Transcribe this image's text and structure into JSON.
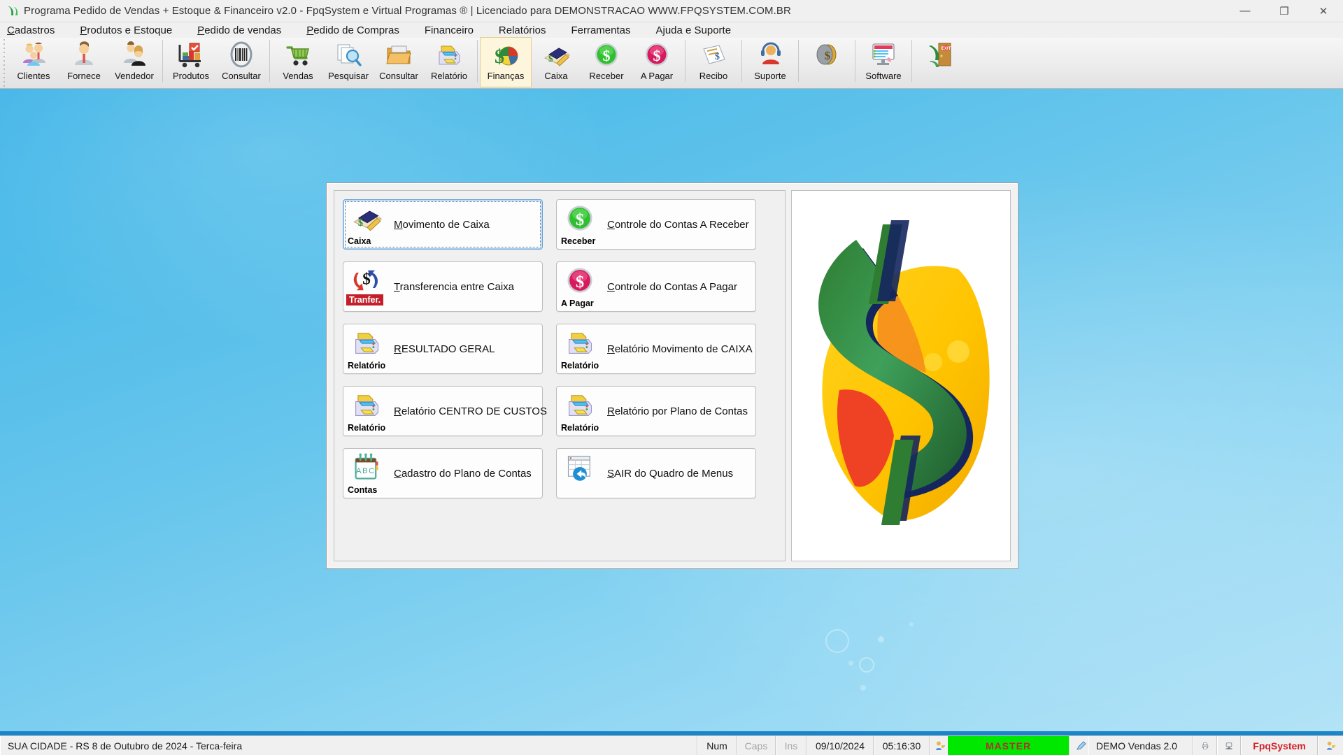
{
  "window": {
    "title": "Programa Pedido de Vendas + Estoque & Financeiro v2.0 - FpqSystem e Virtual Programas ® | Licenciado para  DEMONSTRACAO WWW.FPQSYSTEM.COM.BR",
    "icon": "app-logo-icon",
    "controls": {
      "minimize": "—",
      "maximize": "❐",
      "close": "✕"
    }
  },
  "menubar": {
    "items": [
      {
        "label": "Cadastros",
        "accel": "C"
      },
      {
        "label": "Produtos e Estoque",
        "accel": "P"
      },
      {
        "label": "Pedido de vendas",
        "accel": "P"
      },
      {
        "label": "Pedido de Compras",
        "accel": "P"
      },
      {
        "label": "Financeiro",
        "accel": ""
      },
      {
        "label": "Relatórios",
        "accel": ""
      },
      {
        "label": "Ferramentas",
        "accel": ""
      },
      {
        "label": "Ajuda e Suporte",
        "accel": ""
      }
    ]
  },
  "toolbar": {
    "groups": [
      {
        "buttons": [
          {
            "label": "Clientes",
            "icon": "clients-group-icon",
            "glyph": "👥"
          },
          {
            "label": "Fornece",
            "icon": "supplier-person-icon",
            "glyph": "👔"
          },
          {
            "label": "Vendedor",
            "icon": "salesperson-icon",
            "glyph": "🧑‍💼"
          }
        ]
      },
      {
        "buttons": [
          {
            "label": "Produtos",
            "icon": "product-cart-icon",
            "glyph": "🛒"
          },
          {
            "label": "Consultar",
            "icon": "barcode-icon",
            "glyph": "▮▯▮"
          }
        ]
      },
      {
        "buttons": [
          {
            "label": "Vendas",
            "icon": "shopping-cart-icon",
            "glyph": "🛒"
          },
          {
            "label": "Pesquisar",
            "icon": "search-documents-icon",
            "glyph": "🔍"
          },
          {
            "label": "Consultar",
            "icon": "folder-open-icon",
            "glyph": "🗂"
          },
          {
            "label": "Relatório",
            "icon": "printer-report-icon",
            "glyph": "🖨"
          }
        ]
      },
      {
        "buttons": [
          {
            "label": "Finanças",
            "icon": "finance-piechart-icon",
            "glyph": "📊",
            "selected": true
          },
          {
            "label": "Caixa",
            "icon": "cashbook-icon",
            "glyph": "📒"
          },
          {
            "label": "Receber",
            "icon": "dollar-green-icon",
            "glyph": "$"
          },
          {
            "label": "A Pagar",
            "icon": "dollar-red-icon",
            "glyph": "$"
          }
        ]
      },
      {
        "buttons": [
          {
            "label": "Recibo",
            "icon": "receipt-icon",
            "glyph": "🧾"
          }
        ]
      },
      {
        "buttons": [
          {
            "label": "Suporte",
            "icon": "headset-support-icon",
            "glyph": "🎧"
          }
        ]
      },
      {
        "buttons": [
          {
            "label": "",
            "icon": "coins-icon",
            "glyph": "🪙"
          }
        ]
      },
      {
        "buttons": [
          {
            "label": "Software",
            "icon": "software-monitor-icon",
            "glyph": "🖥"
          }
        ]
      },
      {
        "buttons": [
          {
            "label": "",
            "icon": "exit-door-icon",
            "glyph": "🚪"
          }
        ]
      }
    ]
  },
  "menu_window": {
    "buttons": [
      {
        "label": "Movimento de Caixa",
        "accel": "M",
        "sub": "Caixa",
        "icon": "cashbook-icon",
        "glyph": "📒",
        "focused": true
      },
      {
        "label": "Controle do Contas A Receber",
        "accel": "C",
        "sub": "Receber",
        "icon": "dollar-green-icon",
        "glyph": "$"
      },
      {
        "label": "Transferencia entre Caixa",
        "accel": "T",
        "sub": "Tranfer.",
        "icon": "transfer-arrows-icon",
        "glyph": "$"
      },
      {
        "label": "Controle do Contas A Pagar",
        "accel": "C",
        "sub": "A Pagar",
        "icon": "dollar-red-icon",
        "glyph": "$"
      },
      {
        "label": "RESULTADO GERAL",
        "accel": "R",
        "sub": "Relatório",
        "icon": "printer-report-icon",
        "glyph": "🖨"
      },
      {
        "label": "Relatório Movimento de CAIXA",
        "accel": "R",
        "sub": "Relatório",
        "icon": "printer-report-icon",
        "glyph": "🖨"
      },
      {
        "label": "Relatório CENTRO DE CUSTOS",
        "accel": "R",
        "sub": "Relatório",
        "icon": "printer-report-icon",
        "glyph": "🖨"
      },
      {
        "label": "Relatório por Plano de Contas",
        "accel": "R",
        "sub": "Relatório",
        "icon": "printer-report-icon",
        "glyph": "🖨"
      },
      {
        "label": "Cadastro do Plano de Contas",
        "accel": "C",
        "sub": "Contas",
        "icon": "abc-index-icon",
        "glyph": "ABC"
      },
      {
        "label": "SAIR do Quadro de Menus",
        "accel": "S",
        "sub": "",
        "icon": "exit-back-icon",
        "glyph": "↩"
      }
    ],
    "logo": {
      "icon": "dollar-shield-logo",
      "alt": "Logo cifrão verde e amarelo"
    }
  },
  "statusbar": {
    "location_date": "SUA CIDADE - RS  8 de Outubro de 2024 - Terca-feira",
    "num": "Num",
    "caps": "Caps",
    "ins": "Ins",
    "date": "09/10/2024",
    "time": "05:16:30",
    "user_icon": "user-key-icon",
    "user_level": "MASTER",
    "edition_icon": "pen-icon",
    "edition": "DEMO Vendas 2.0",
    "printer_icon": "printer-icon",
    "network_icon": "network-icon",
    "brand": "FpqSystem",
    "brand_icon": "user-key-icon"
  },
  "colors": {
    "desktop_blue": "#4fbce9",
    "master_green": "#00e800",
    "master_text": "#b03030",
    "brand_red": "#d2232a",
    "accent_blue": "#1a85c9"
  }
}
